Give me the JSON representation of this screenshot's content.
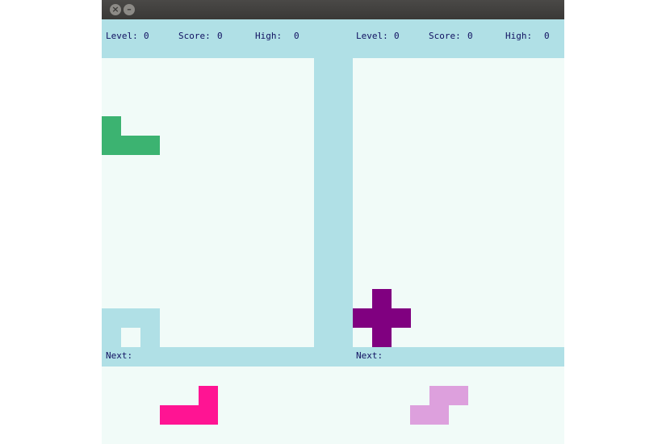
{
  "window": {
    "buttons": [
      {
        "name": "close",
        "glyph": "×"
      },
      {
        "name": "minimize",
        "glyph": "–"
      }
    ]
  },
  "players": [
    {
      "level_label": "Level:",
      "level": "0",
      "score_label": "Score:",
      "score": "0",
      "high_label": "High:",
      "high": "0",
      "next_label": "Next:"
    },
    {
      "level_label": "Level:",
      "level": "0",
      "score_label": "Score:",
      "score": "0",
      "high_label": "High:",
      "high": "0",
      "next_label": "Next:"
    }
  ],
  "colors": {
    "board_background": "#f1fbf8",
    "frame": "#b0e0e6",
    "text": "#101060",
    "falling_piece_left": "#3cb371",
    "falling_piece_right": "#800080",
    "next_piece_left": "#ff1493",
    "next_piece_right": "#dda0dd",
    "settled_blocks": "#b0e0e6"
  }
}
